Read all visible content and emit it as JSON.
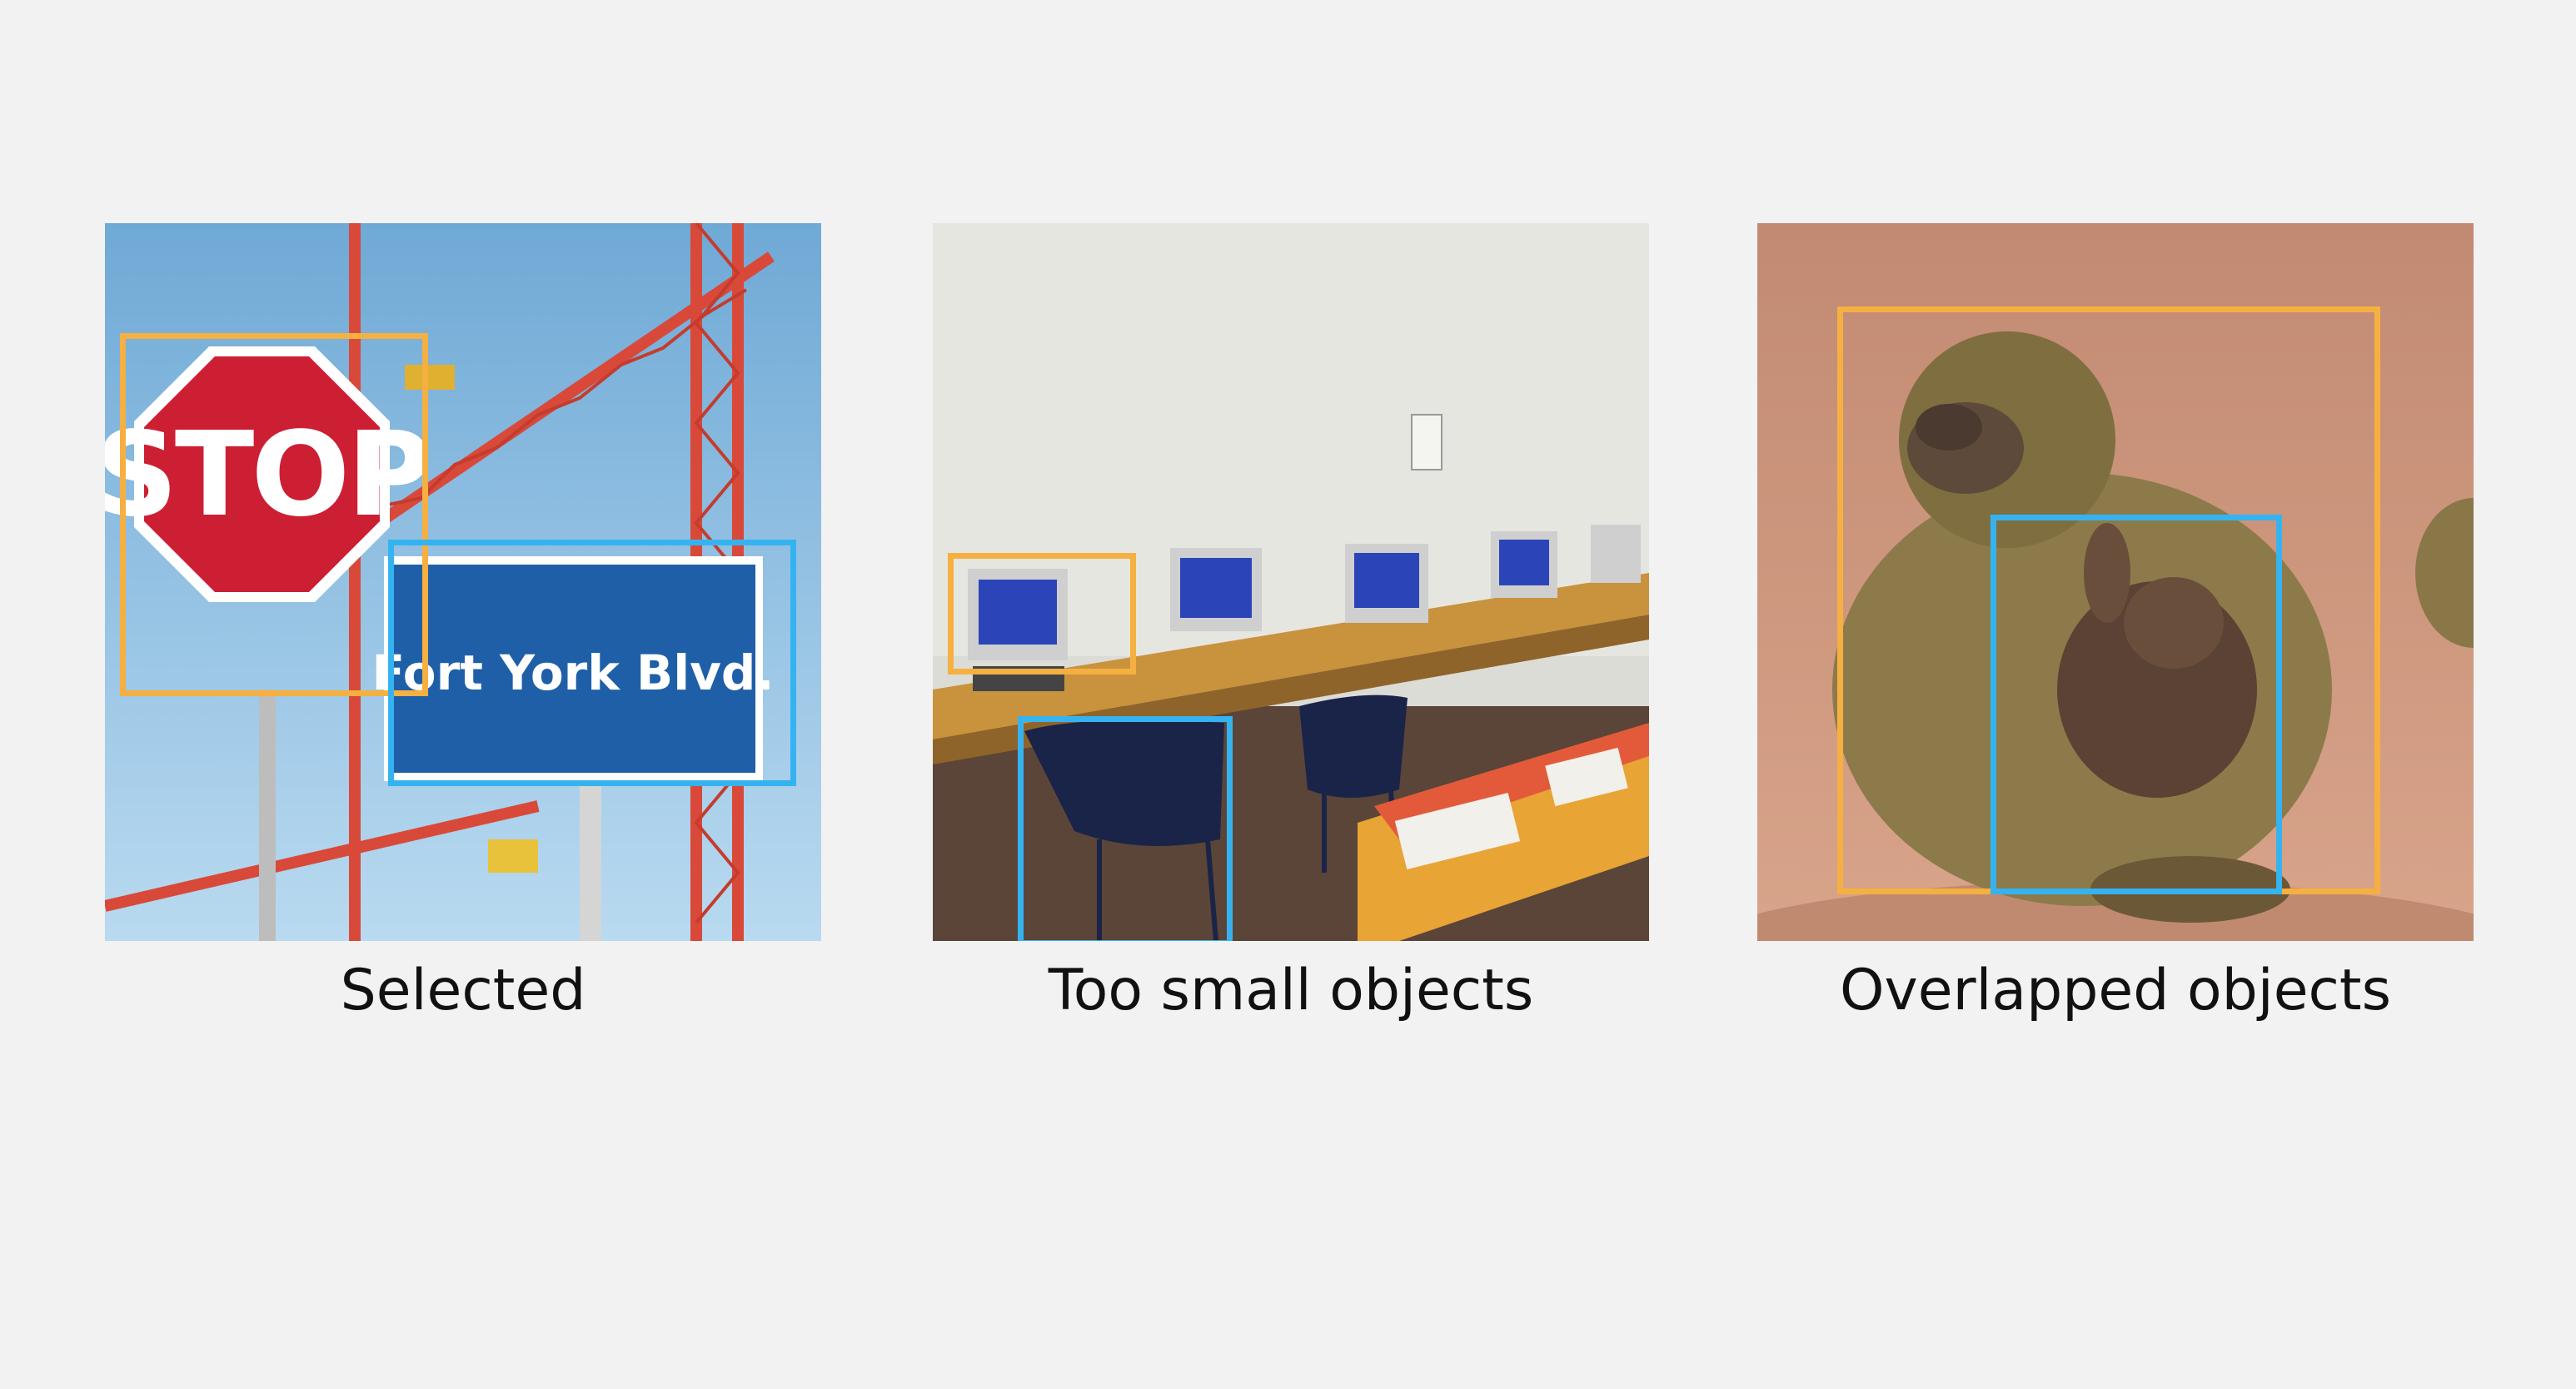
{
  "colors": {
    "background": "#f2f2f2",
    "box_orange": "#f5b041",
    "box_blue": "#35b3f0"
  },
  "panels": [
    {
      "caption": "Selected",
      "sign_stop": "STOP",
      "sign_street": "Fort York Blvd."
    },
    {
      "caption": "Too small objects"
    },
    {
      "caption": "Overlapped objects"
    }
  ]
}
